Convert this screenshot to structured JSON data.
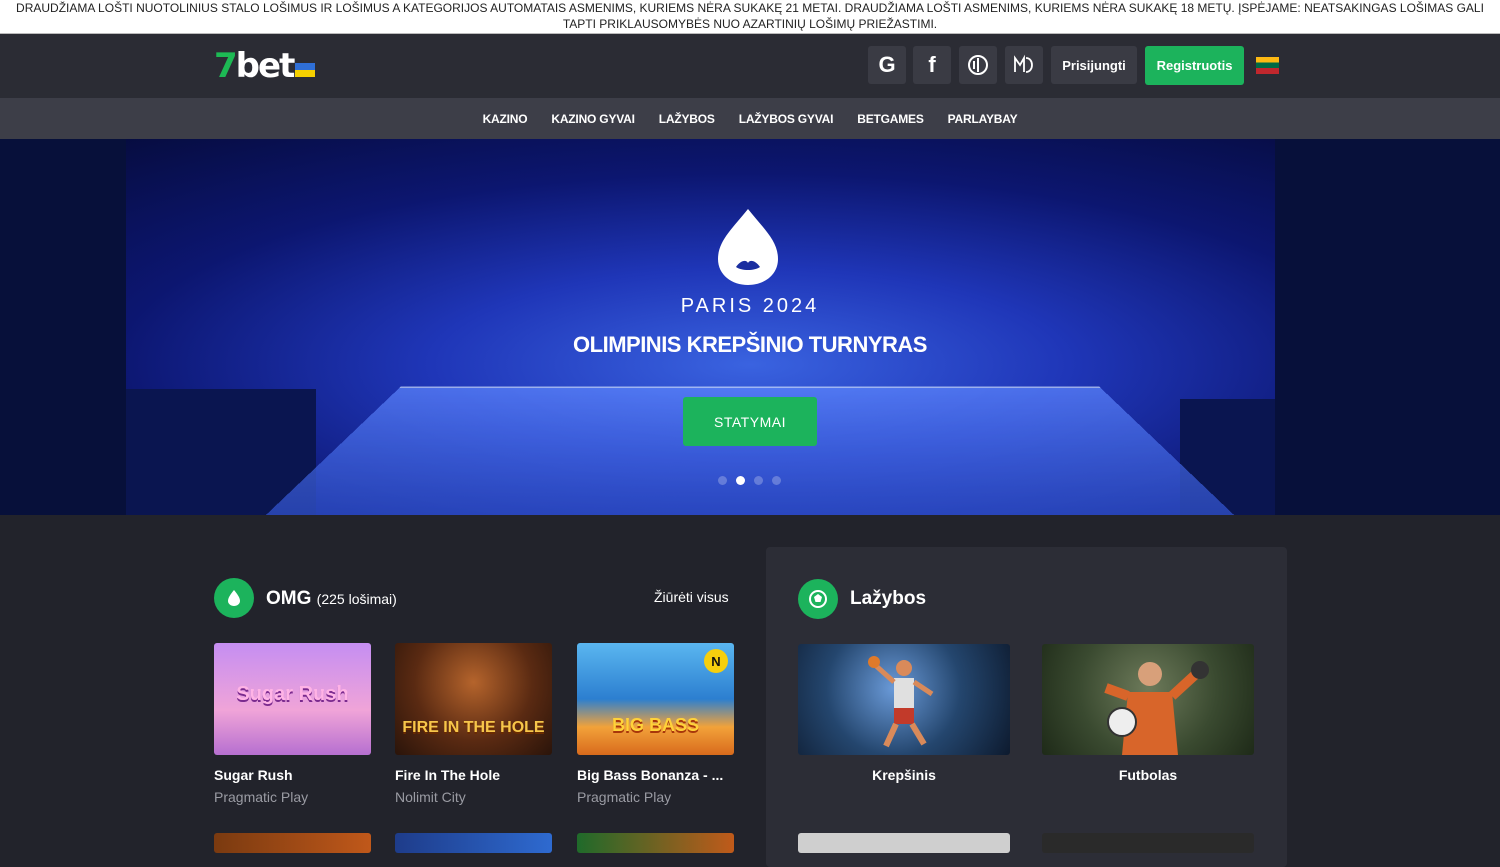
{
  "warning": {
    "line1": "DRAUDŽIAMA LOŠTI NUOTOLINIUS STALO LOŠIMUS IR LOŠIMUS A KATEGORIJOS AUTOMATAIS ASMENIMS, KURIEMS NĖRA SUKAKĘ 21 METAI. DRAUDŽIAMA LOŠTI ASMENIMS, KURIEMS NĖRA SUKAKĘ 18 METŲ. ĮSPĖJAME: NEATSAKINGAS LOŠIMAS GALI",
    "line2": "TAPTI PRIKLAUSOMYBĖS NUO AZARTINIŲ LOŠIMŲ PRIEŽASTIMI."
  },
  "header": {
    "logo_seven": "7",
    "logo_bet": "bet",
    "social": [
      "G",
      "f",
      "◐",
      "M"
    ],
    "login_label": "Prisijungti",
    "register_label": "Registruotis"
  },
  "nav": {
    "items": [
      "KAZINO",
      "KAZINO GYVAI",
      "LAŽYBOS",
      "LAŽYBOS GYVAI",
      "BETGAMES",
      "PARLAYBAY"
    ]
  },
  "hero": {
    "subtitle": "PARIS 2024",
    "title": "OLIMPINIS KREPŠINIO TURNYRAS",
    "button_label": "STATYMAI",
    "slides": 4,
    "active_slide": 2
  },
  "omg": {
    "title": "OMG",
    "count": "(225 lošimai)",
    "view_all": "Žiūrėti visus",
    "games": [
      {
        "name": "Sugar Rush",
        "provider": "Pragmatic Play",
        "thumb_text": "Sugar Rush",
        "badge": ""
      },
      {
        "name": "Fire In The Hole",
        "provider": "Nolimit City",
        "thumb_text": "FIRE IN THE HOLE",
        "badge": ""
      },
      {
        "name": "Big Bass Bonanza - ...",
        "provider": "Pragmatic Play",
        "thumb_text": "BIG BASS",
        "badge": "N"
      }
    ]
  },
  "betting": {
    "title": "Lažybos",
    "sports": [
      {
        "name": "Krepšinis"
      },
      {
        "name": "Futbolas"
      }
    ]
  },
  "colors": {
    "accent": "#1cb35c",
    "topbar": "#2b2c34",
    "nav": "#3d3e48",
    "page": "#22232b"
  }
}
